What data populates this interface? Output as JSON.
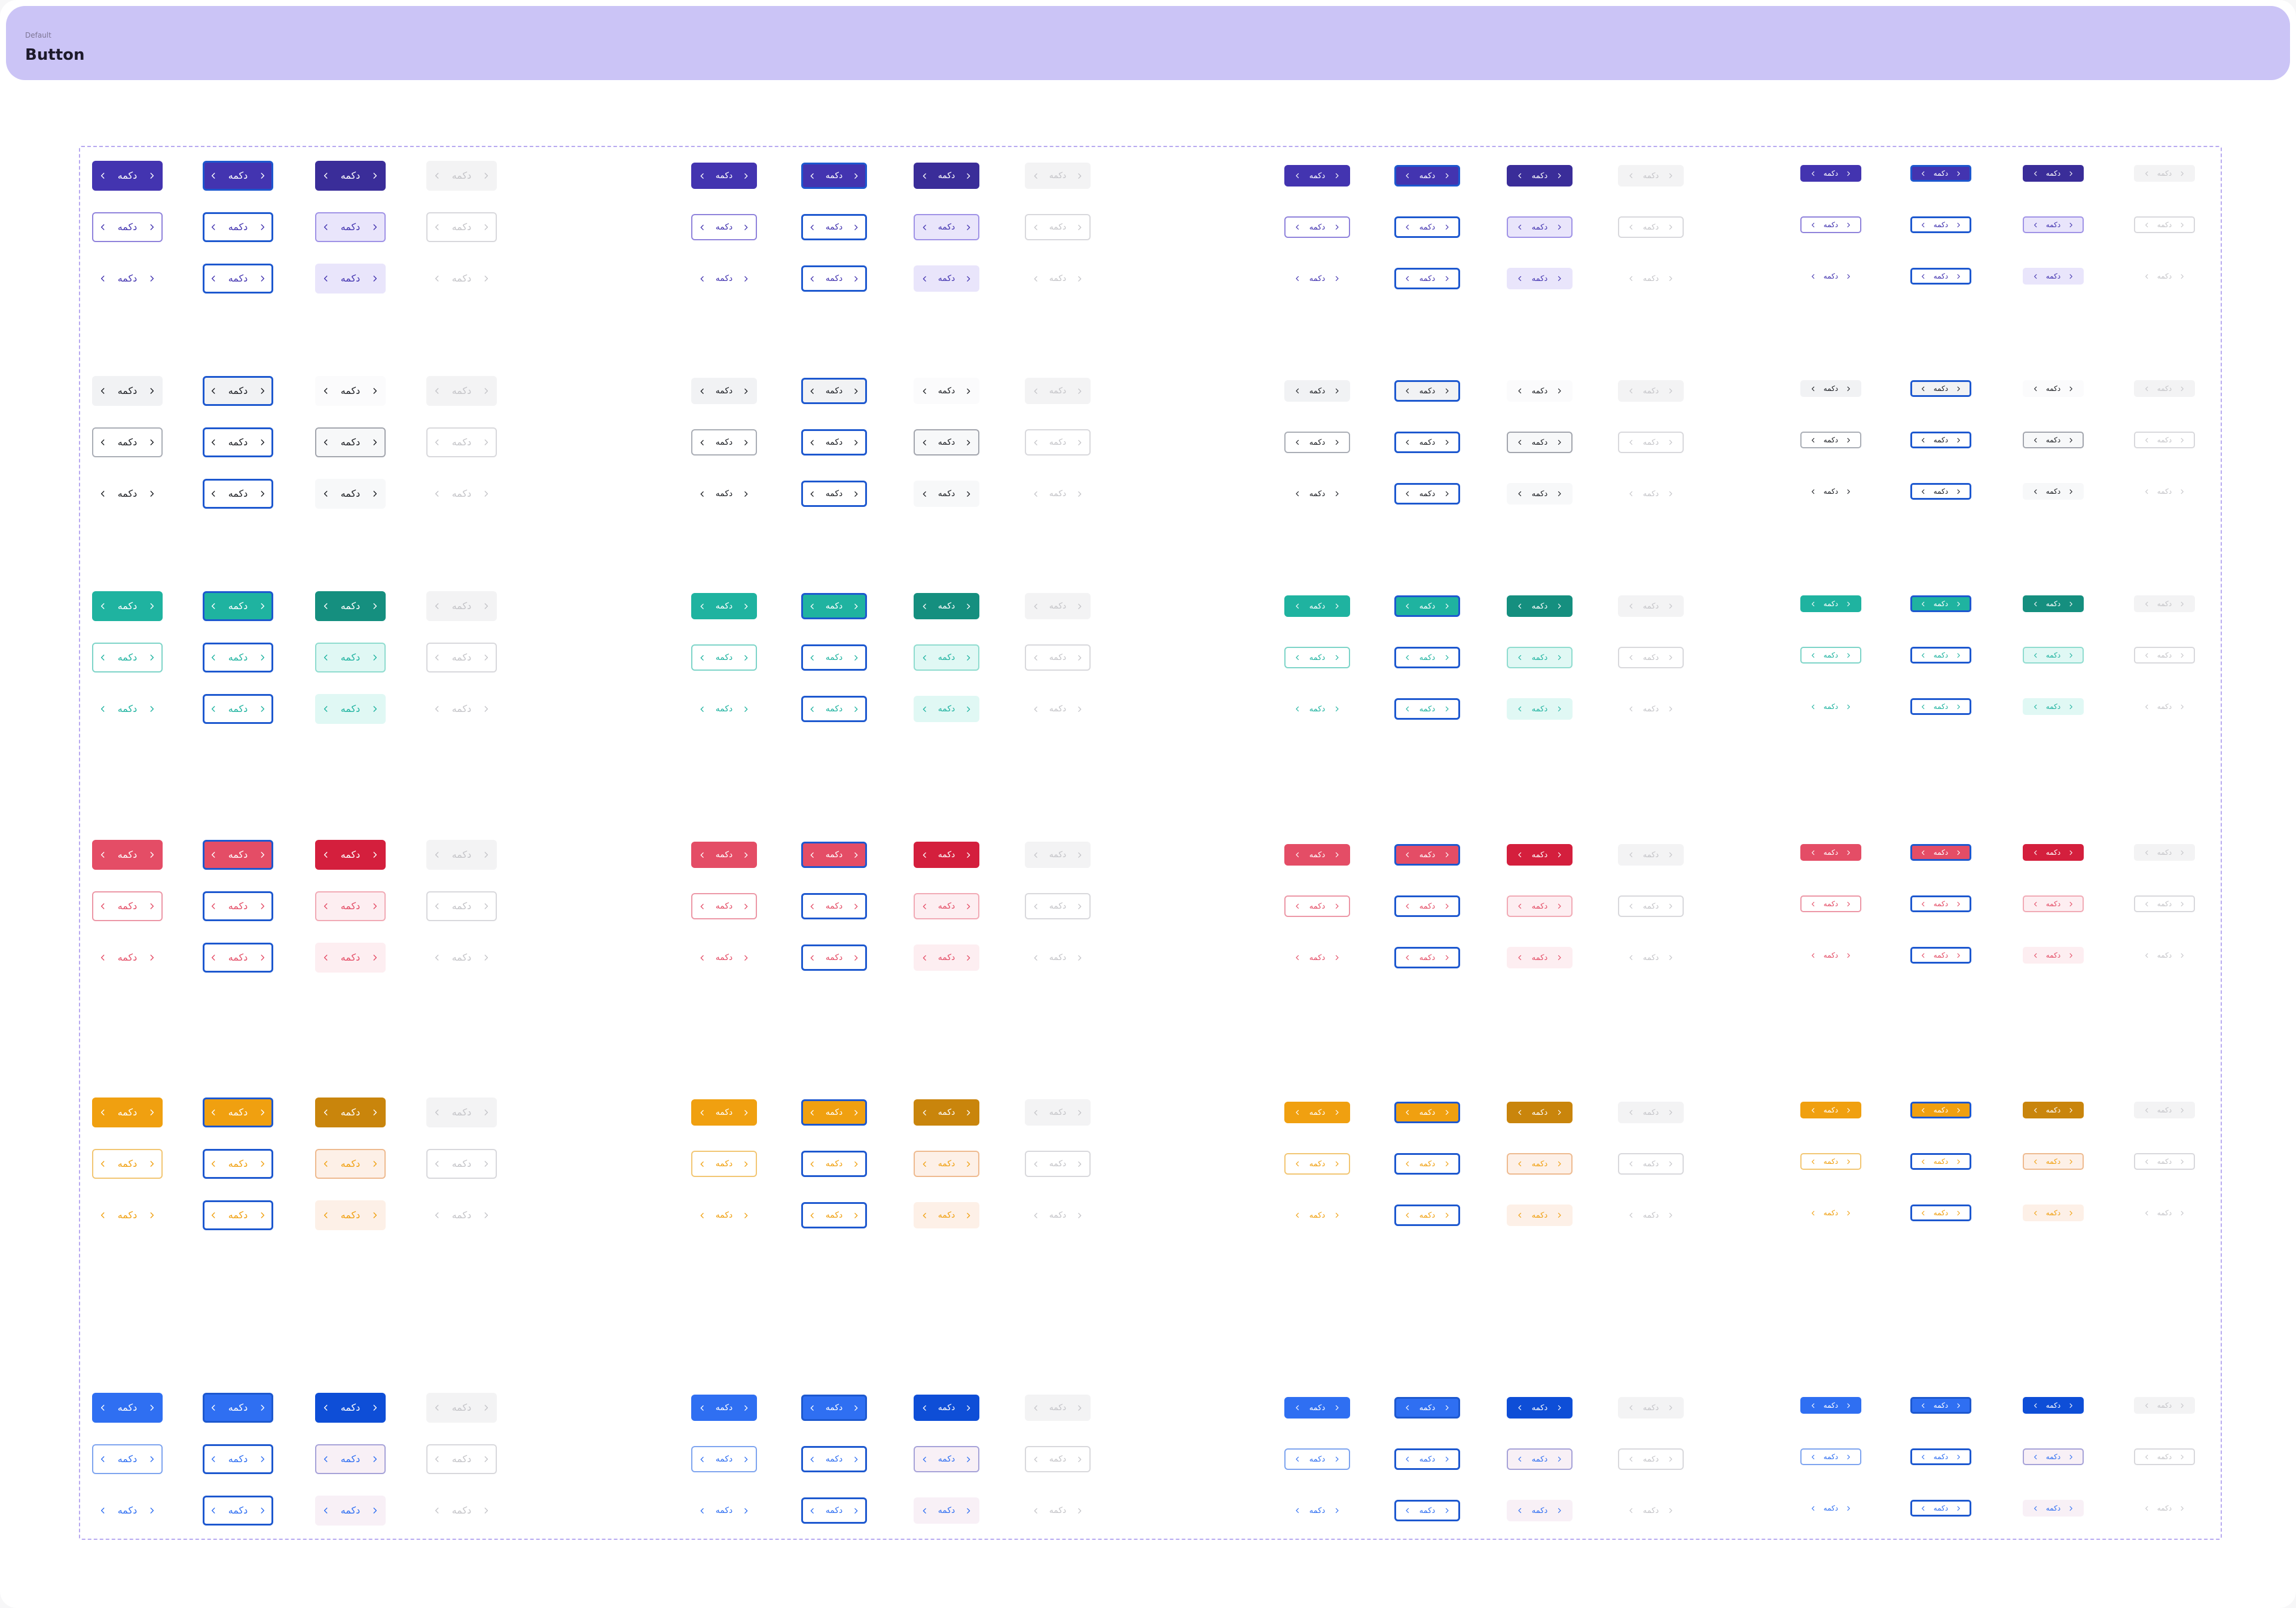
{
  "header": {
    "label": "Default",
    "title": "Button"
  },
  "button_label": "دکمه",
  "icons": {
    "leading": "chevron-left-icon",
    "trailing": "chevron-right-icon"
  },
  "columns": [
    "default",
    "focused",
    "pressed",
    "disabled"
  ],
  "variants": [
    "filled",
    "outlined",
    "text"
  ],
  "sizes": [
    "large",
    "medium",
    "small",
    "x-small"
  ],
  "colors": {
    "primary": {
      "base": "#4334b0",
      "pressed": "#3a2d99",
      "outline": "#8f82db",
      "pressed_tint": "#e9e5fb",
      "pressed_border": "#9f92e6",
      "on_base": "#ffffff",
      "focus_ring": "#1d58cf"
    },
    "neutral": {
      "base": "#f1f2f4",
      "pressed": "#fbfbfc",
      "outline": "#a9adb5",
      "pressed_tint": "#f7f8f9",
      "pressed_border": "#a2a5ad",
      "on_base": "#1b1d22",
      "fg": "#1b1d22",
      "focus_ring": "#1d58cf"
    },
    "success": {
      "base": "#1fb3a0",
      "pressed": "#158f7f",
      "outline": "#7dd4c8",
      "pressed_tint": "#e0f8f4",
      "pressed_border": "#8fdccf",
      "on_base": "#ffffff",
      "focus_ring": "#1d58cf"
    },
    "danger": {
      "base": "#e44d66",
      "pressed": "#d41f3d",
      "outline": "#ec97a6",
      "pressed_tint": "#fdeef1",
      "pressed_border": "#f1aab5",
      "on_base": "#ffffff",
      "focus_ring": "#1d58cf"
    },
    "warning": {
      "base": "#f0a010",
      "pressed": "#c9850c",
      "outline": "#f2c673",
      "pressed_tint": "#fdf0e7",
      "pressed_border": "#eeba8f",
      "on_base": "#ffffff",
      "focus_ring": "#1d58cf"
    },
    "info": {
      "base": "#2f6ff2",
      "pressed": "#0e4ed7",
      "outline": "#7ea4ef",
      "pressed_tint": "#f8f0f6",
      "pressed_border": "#a6a2d8",
      "on_base": "#ffffff",
      "focus_ring": "#1d58cf"
    },
    "disabled": {
      "fill": "#f3f3f4",
      "text": "#c4c4c8",
      "border": "#d8d8dc"
    },
    "focus_fill": "#ffffff"
  }
}
